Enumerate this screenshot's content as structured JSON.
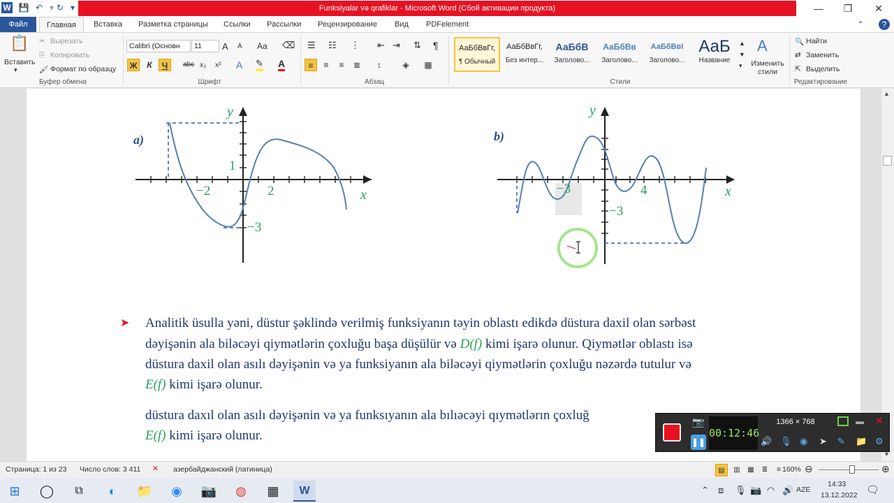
{
  "window": {
    "title": "Funksiyalar və qrafiklar  -  Microsoft Word (Сбой активации продукта)",
    "quick_access": [
      "save-icon",
      "undo-icon",
      "redo-icon",
      "customize-icon"
    ]
  },
  "tabs": [
    "Файл",
    "Главная",
    "Вставка",
    "Разметка страницы",
    "Ссылки",
    "Рассылки",
    "Рецензирование",
    "Вид",
    "PDFelement"
  ],
  "ribbon": {
    "clipboard": {
      "paste": "Вставить",
      "cut": "Вырезать",
      "copy": "Копировать",
      "format_painter": "Формат по образцу",
      "label": "Буфер обмена"
    },
    "font": {
      "name": "Calibri (Основн",
      "size": "11",
      "label": "Шрифт",
      "bold": "Ж",
      "italic": "К",
      "underline": "Ч",
      "strike": "abc",
      "sub": "x₂",
      "sup": "x²",
      "case": "Aa",
      "grow": "A",
      "shrink": "A"
    },
    "paragraph": {
      "label": "Абзац"
    },
    "styles": {
      "label": "Стили",
      "items": [
        {
          "preview": "АаБбВвГг,",
          "name": "¶ Обычный"
        },
        {
          "preview": "АаБбВвГг,",
          "name": "Без интер..."
        },
        {
          "preview": "АаБбВ",
          "name": "Заголово..."
        },
        {
          "preview": "АаБбВв",
          "name": "Заголово..."
        },
        {
          "preview": "АаБбВвI",
          "name": "Заголово..."
        },
        {
          "preview": "АаБ",
          "name": "Название"
        }
      ],
      "change": "Изменить стили"
    },
    "editing": {
      "label": "Редактирование",
      "find": "Найти",
      "replace": "Заменить",
      "select": "Выделить"
    }
  },
  "document": {
    "graph_a": {
      "label": "a)",
      "ticks": [
        "−2",
        "2",
        "1",
        "−3"
      ],
      "xaxis": "x",
      "yaxis": "y"
    },
    "graph_b": {
      "label": "b)",
      "ticks": [
        "−3",
        "4",
        "−3"
      ],
      "xaxis": "x",
      "yaxis": "y"
    },
    "paragraph1": {
      "bullet": "➤",
      "line1": "Analitik üsulla yəni, düstur  şəklində verilmiş funksiyanın təyin oblastı edikdə düstura daxil olan sərbəst",
      "line2a": "dəyişənin ala biləcəyi qiymətlərin çoxluğu başa düşülür və ",
      "line2m": "D(f)",
      "line2b": " kimi işarə olunur. Qiymətlər oblastı  isə",
      "line3": "düstura daxil olan asılı dəyişənin və ya  funksiyanın ala biləcəyi qiymətlərin çoxluğu nəzərdə tutulur  və",
      "line4m": "E(f)",
      "line4b": " kimi işarə olunur."
    },
    "paragraph2": {
      "line1": "düstura daxıl olan asılı dəyişənin və ya  funksıyanın ala bılıəcəyi qıymətlərın çoxluğ",
      "line2m": "E(f)",
      "line2b": " kimi işarə olunur."
    }
  },
  "recorder": {
    "resolution": "1366 × 768",
    "timer": "00:12:46"
  },
  "statusbar": {
    "page": "Страница: 1 из 23",
    "words": "Число слов: 3 411",
    "language": "азербайджанский (латиница)",
    "zoom": "160%"
  },
  "taskbar": {
    "lang": "AZE",
    "time": "14:33",
    "date": "13.12.2022"
  },
  "colors": {
    "accent": "#2b579a",
    "title_bar": "#e81123",
    "math": "#2aa05a",
    "text": "#1f3a6e"
  }
}
